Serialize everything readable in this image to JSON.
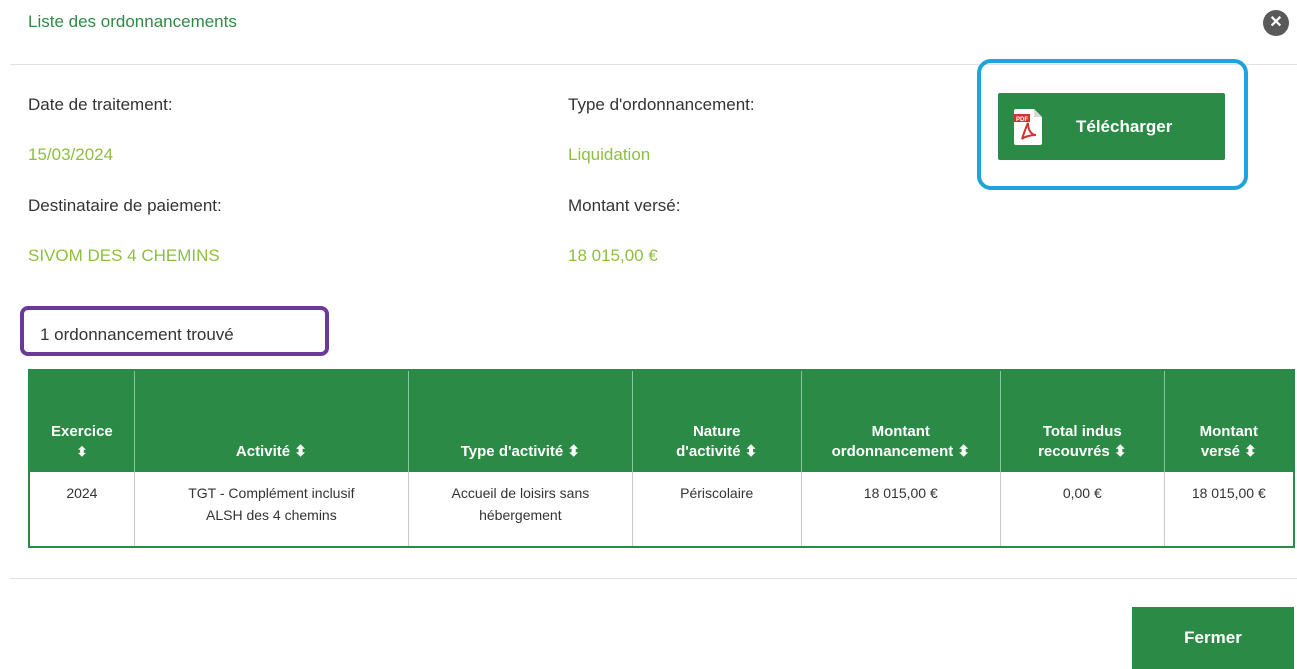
{
  "modal": {
    "title": "Liste des ordonnancements",
    "close_icon": "close-icon"
  },
  "info": {
    "date_label": "Date de traitement:",
    "date_value": "15/03/2024",
    "type_label": "Type d'ordonnancement:",
    "type_value": "Liquidation",
    "recipient_label": "Destinataire de paiement:",
    "recipient_value": "SIVOM DES 4 CHEMINS",
    "amount_label": "Montant versé:",
    "amount_value": "18 015,00 €"
  },
  "download": {
    "label": "Télécharger",
    "icon": "pdf-icon"
  },
  "results": {
    "count_text": "1 ordonnancement trouvé",
    "columns": [
      {
        "line1": "Exercice",
        "line2": "⬍"
      },
      {
        "line1": "Activité ⬍",
        "line2": ""
      },
      {
        "line1": "Type d'activité ⬍",
        "line2": ""
      },
      {
        "line1": "Nature",
        "line2": "d'activité ⬍"
      },
      {
        "line1": "Montant",
        "line2": "ordonnancement ⬍"
      },
      {
        "line1": "Total indus",
        "line2": "recouvrés ⬍"
      },
      {
        "line1": "Montant",
        "line2": "versé ⬍"
      }
    ],
    "rows": [
      {
        "exercice": "2024",
        "activite_1": "TGT - Complément inclusif",
        "activite_2": "ALSH des 4 chemins",
        "type_1": "Accueil de loisirs sans",
        "type_2": "hébergement",
        "nature": "Périscolaire",
        "montant_ord": "18 015,00 €",
        "total_indus": "0,00 €",
        "montant_verse": "18 015,00 €"
      }
    ]
  },
  "footer": {
    "close_label": "Fermer"
  },
  "colors": {
    "primary_green": "#2b8a45",
    "title_green": "#2f8a45",
    "value_green": "#8dbf3f",
    "highlight_blue": "#1ea3dc",
    "highlight_purple": "#6b3a98"
  }
}
